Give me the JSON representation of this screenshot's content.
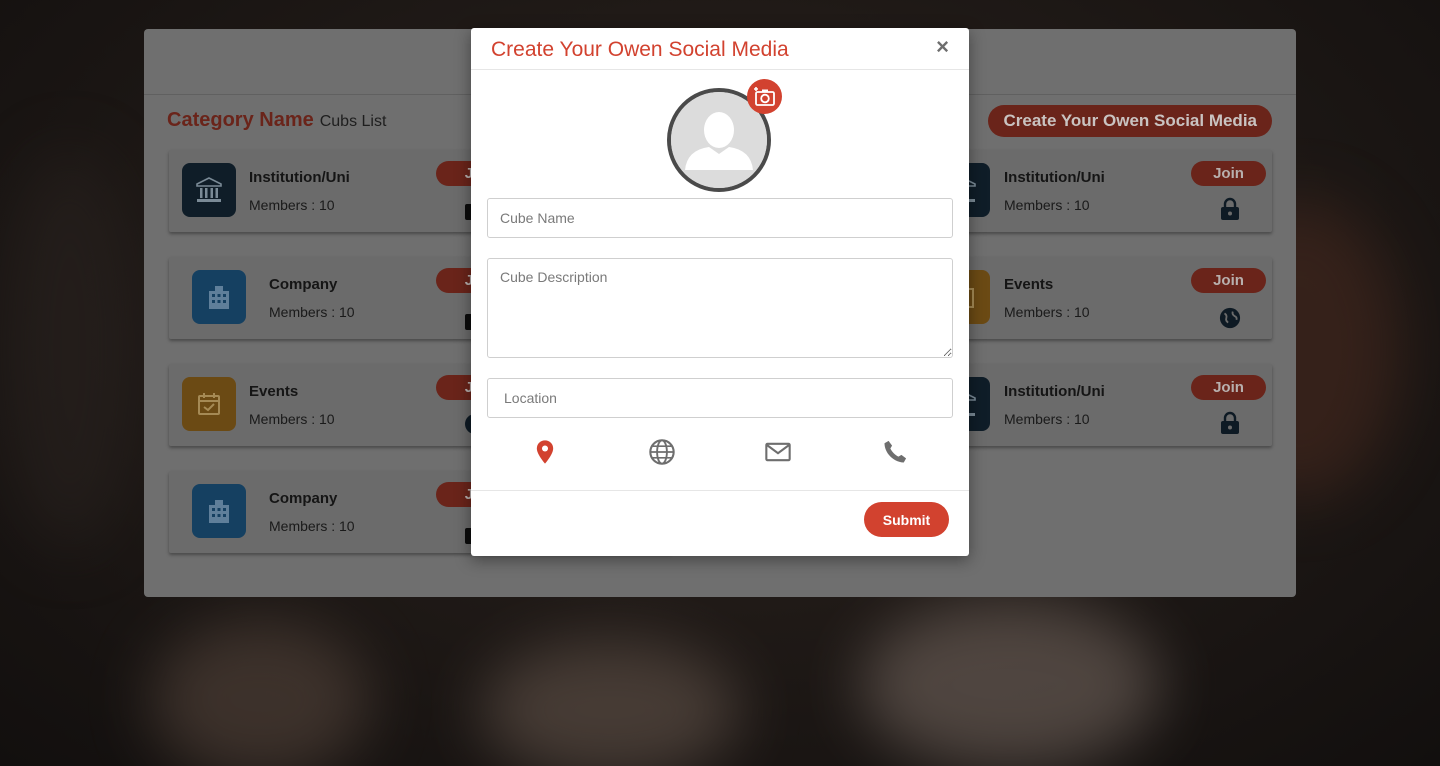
{
  "page": {
    "category_name": "Category Name",
    "list_label": "Cubs List",
    "create_button": "Create Your Owen Social Media"
  },
  "cards": [
    {
      "title": "Institution/Uni",
      "members": "Members : 10",
      "join": "Jo",
      "type": "institution",
      "status_icon": "lock-icon"
    },
    {
      "title": "Institution/Uni",
      "members": "Members : 10",
      "join": "Join",
      "type": "institution",
      "status_icon": "lock-icon"
    },
    {
      "title": "Company",
      "members": "Members : 10",
      "join": "Jo",
      "type": "company",
      "status_icon": "lock-icon"
    },
    {
      "title": "Events",
      "members": "Members : 10",
      "join": "Join",
      "type": "events",
      "status_icon": "globe-icon"
    },
    {
      "title": "Events",
      "members": "Members : 10",
      "join": "Jo",
      "type": "events",
      "status_icon": "globe-icon"
    },
    {
      "title": "Institution/Uni",
      "members": "Members : 10",
      "join": "Join",
      "type": "institution",
      "status_icon": "lock-icon"
    },
    {
      "title": "Company",
      "members": "Members : 10",
      "join": "Jo",
      "type": "company",
      "status_icon": "lock-icon"
    }
  ],
  "modal": {
    "title": "Create Your Owen Social Media",
    "close": "×",
    "cube_name_placeholder": "Cube Name",
    "cube_description_placeholder": "Cube Description",
    "location_placeholder": "Location",
    "icons": [
      "location-pin-icon",
      "globe-icon",
      "mail-icon",
      "phone-icon"
    ],
    "submit": "Submit"
  },
  "colors": {
    "accent": "#d2422f",
    "institution": "#1d3b52",
    "company": "#2b8fdb",
    "events": "#e8a33b"
  }
}
